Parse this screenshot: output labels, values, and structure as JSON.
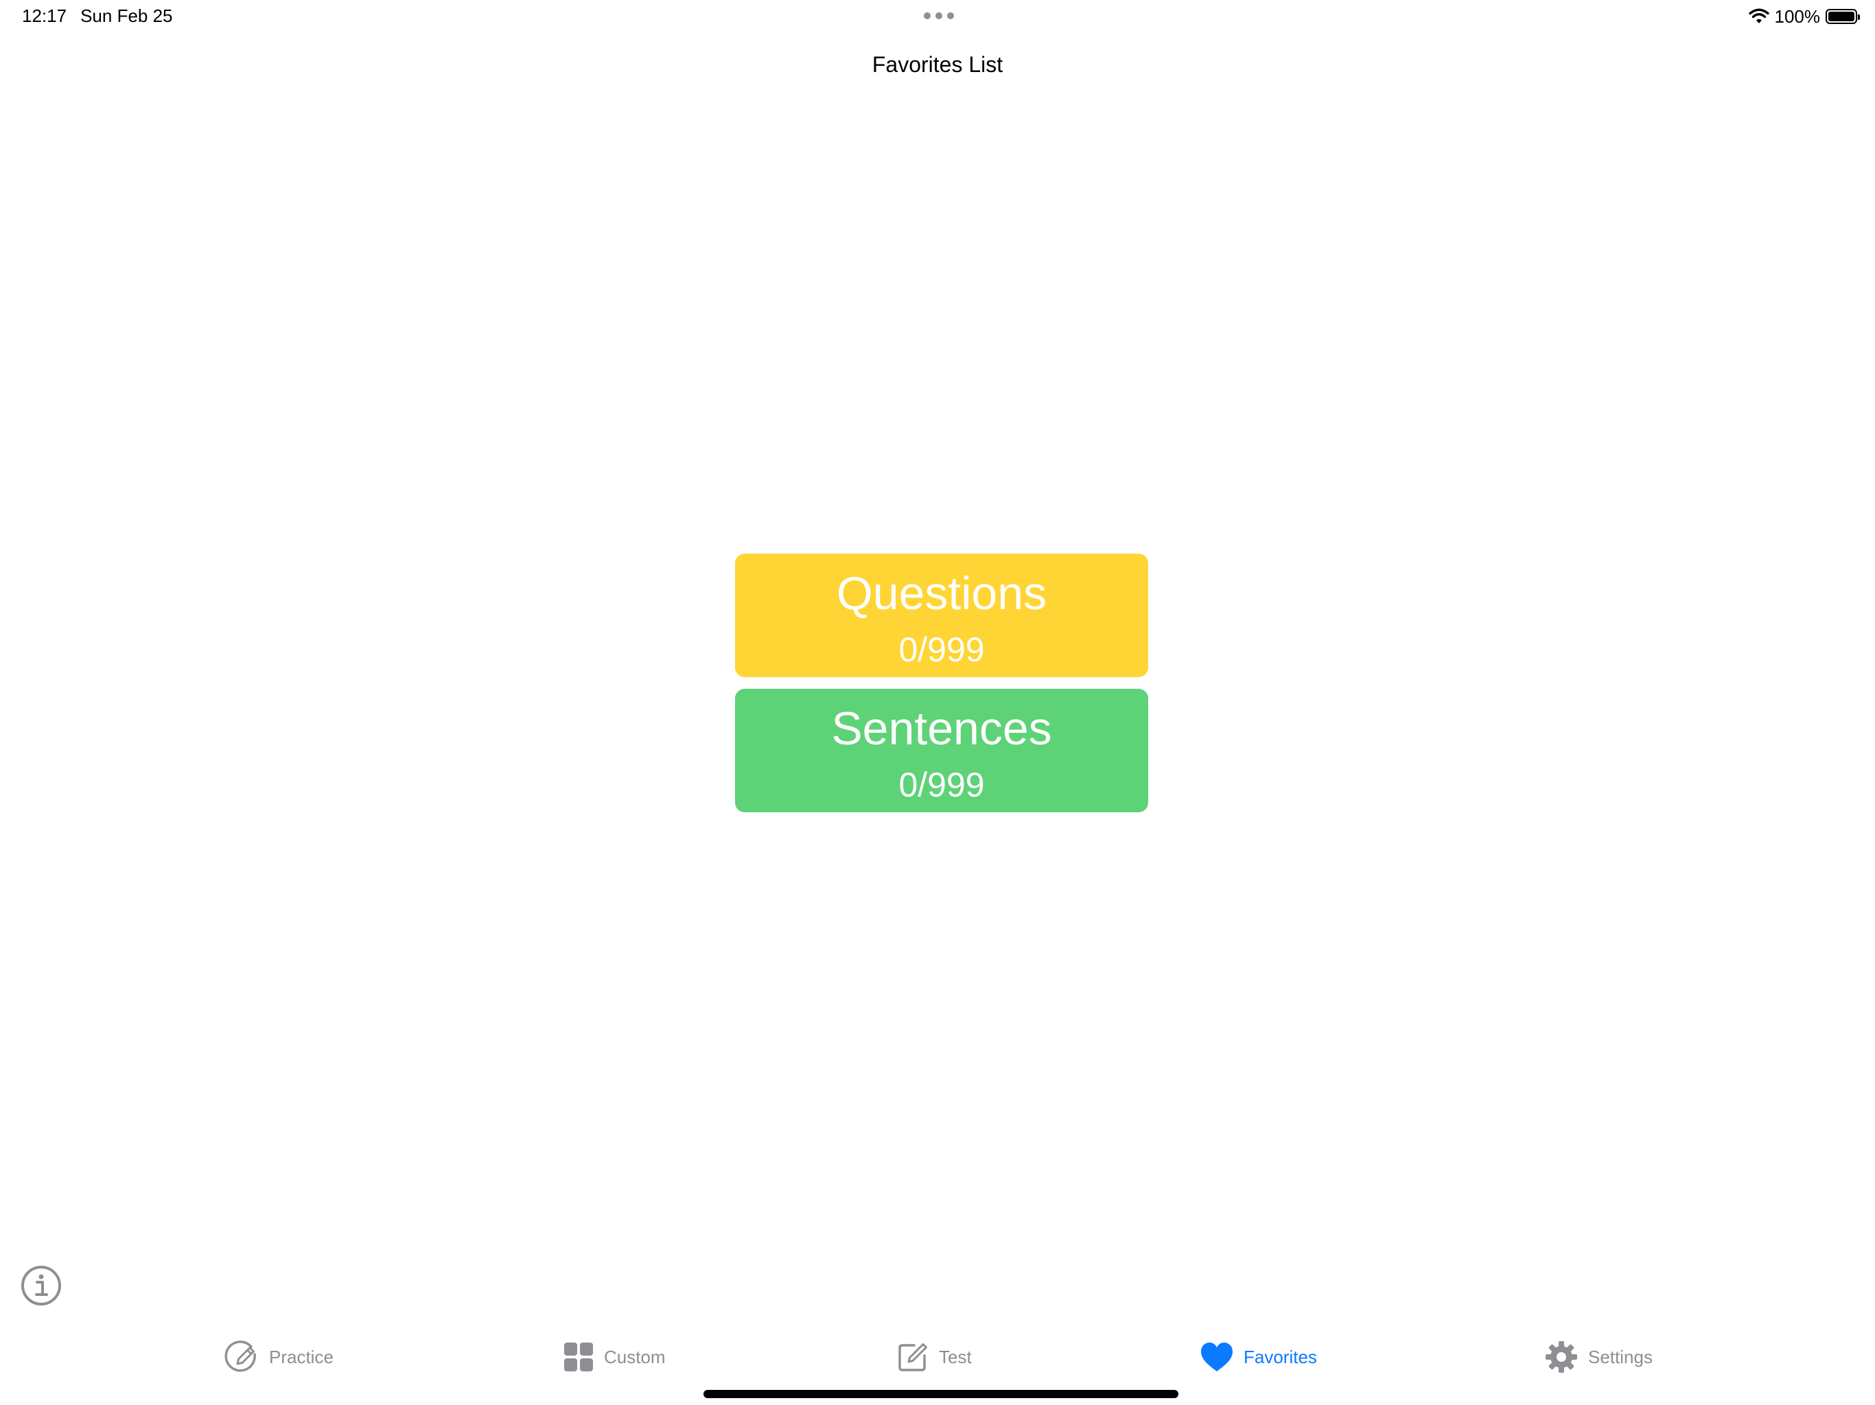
{
  "status_bar": {
    "time": "12:17",
    "date": "Sun Feb 25",
    "battery": "100%",
    "battery_level": 1.0
  },
  "nav": {
    "title": "Favorites List"
  },
  "cards": [
    {
      "title": "Questions",
      "count": "0/999",
      "color": "#fed534"
    },
    {
      "title": "Sentences",
      "count": "0/999",
      "color": "#5dd277"
    }
  ],
  "icons": {
    "info": "info-circle-icon",
    "wifi": "wifi-icon",
    "battery": "battery-icon"
  },
  "tab_bar": {
    "active_color": "#0a7aff",
    "inactive_color": "#8e8e93",
    "tabs": [
      {
        "label": "Practice",
        "icon": "pencil-circle-icon",
        "active": false
      },
      {
        "label": "Custom",
        "icon": "grid-icon",
        "active": false
      },
      {
        "label": "Test",
        "icon": "square-pencil-icon",
        "active": false
      },
      {
        "label": "Favorites",
        "icon": "heart-icon",
        "active": true
      },
      {
        "label": "Settings",
        "icon": "gear-icon",
        "active": false
      }
    ]
  }
}
